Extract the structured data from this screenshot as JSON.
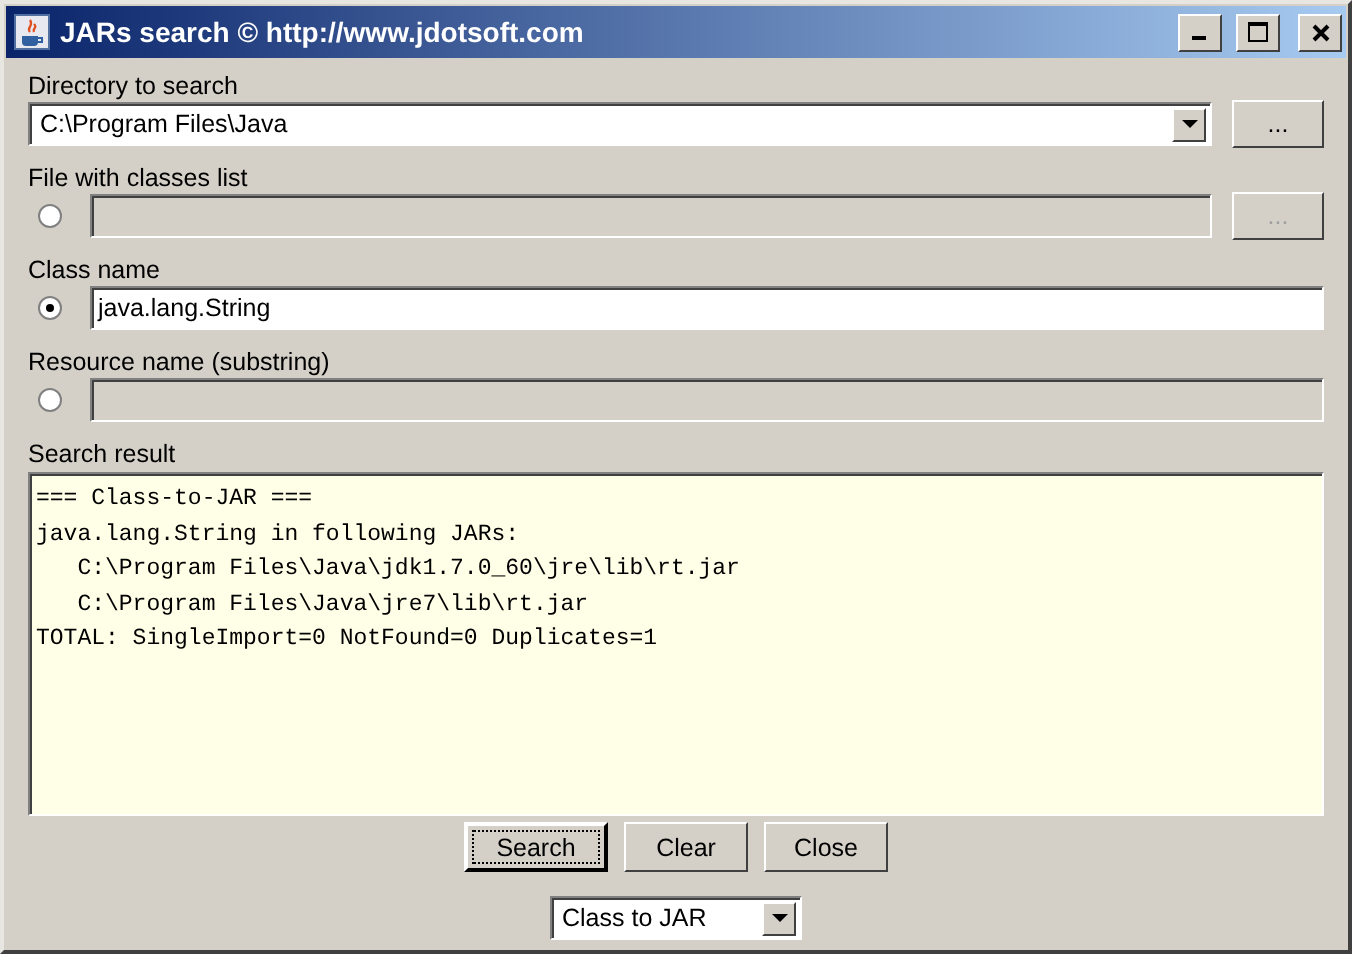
{
  "window": {
    "title": "JARs search © http://www.jdotsoft.com"
  },
  "directory": {
    "label": "Directory to search",
    "value": "C:\\Program Files\\Java",
    "browse_button": "..."
  },
  "sources": [
    {
      "label": "File with classes list",
      "selected": false,
      "disabled": true,
      "browse_button": "..."
    },
    {
      "label": "Class name",
      "selected": true,
      "disabled": false,
      "value": "java.lang.String"
    },
    {
      "label": "Resource name (substring)",
      "selected": false,
      "disabled": true
    }
  ],
  "result": {
    "label": "Search result",
    "lines": [
      "=== Class-to-JAR ===",
      "java.lang.String in following JARs:",
      "   C:\\Program Files\\Java\\jdk1.7.0_60\\jre\\lib\\rt.jar",
      "   C:\\Program Files\\Java\\jre7\\lib\\rt.jar",
      "TOTAL: SingleImport=0 NotFound=0 Duplicates=1"
    ]
  },
  "buttons": [
    {
      "label": "Search",
      "focused": true
    },
    {
      "label": "Clear",
      "focused": false
    },
    {
      "label": "Close",
      "focused": false
    }
  ],
  "mode": {
    "value": "Class to JAR"
  }
}
